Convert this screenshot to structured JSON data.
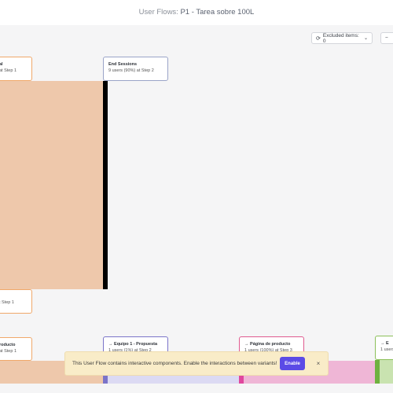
{
  "header": {
    "title_prefix": "User Flows:",
    "title_flow": "P1 - Tarea sobre 100L"
  },
  "toolbar": {
    "excluded_label": "Excluded items: 0",
    "excluded_icon": "refresh-icon",
    "minus": "−"
  },
  "nodes": {
    "step1_top": {
      "title": "al",
      "sub": "at Step 1"
    },
    "end_sessions": {
      "title": "End Sessions",
      "sub": "9 users (90%) at Step 2"
    },
    "step1_mid": {
      "sub": "t Step 1"
    },
    "producto_left": {
      "title": "roducto",
      "sub": "at Step 1"
    },
    "equipo": {
      "title": "→  Equipo 1 - Propuesta",
      "sub": "1 users (1%) at Step 2"
    },
    "pagina": {
      "title": "→  Página de producto",
      "sub": "1 users (100%) at Step 3"
    },
    "right_edge": {
      "title": "→ E",
      "sub": "1 users"
    }
  },
  "banner": {
    "message": "This User Flow contains interactive components. Enable the interactions between variants!",
    "enable_label": "Enable",
    "close_label": "×"
  },
  "colors": {
    "orange_flow": "#eec8ab",
    "orange_border": "#f0a86a",
    "end_border": "#9aa4c8",
    "purple_border": "#7b74c9",
    "pink_border": "#e05a8f",
    "green_border": "#8cc05a",
    "banner_bg": "#f9ecc8",
    "enable_bg": "#5b4be6"
  }
}
